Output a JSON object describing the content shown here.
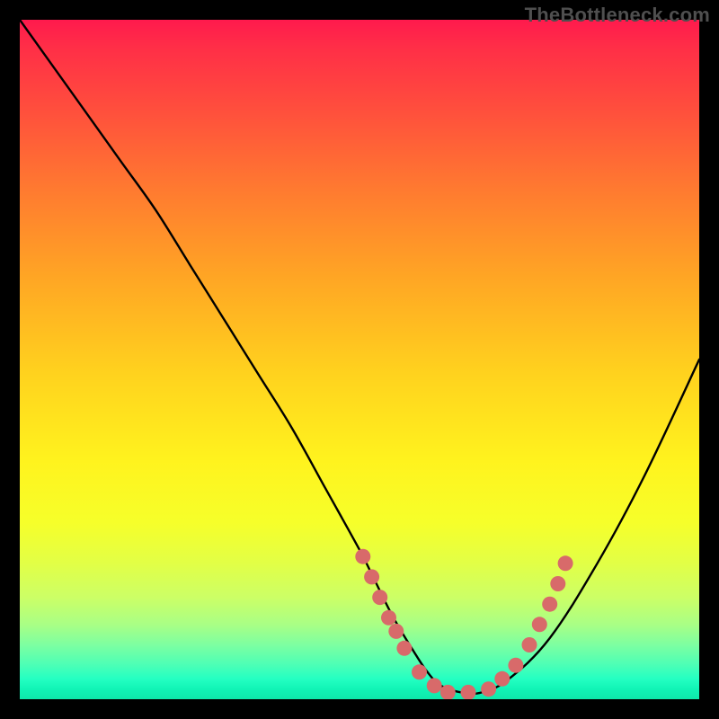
{
  "watermark": "TheBottleneck.com",
  "colors": {
    "frame": "#000000",
    "curve_stroke": "#000000",
    "marker_fill": "#d86a6a",
    "watermark_text": "#4f4f4f"
  },
  "chart_data": {
    "type": "line",
    "title": "",
    "xlabel": "",
    "ylabel": "",
    "xlim": [
      0,
      100
    ],
    "ylim": [
      0,
      100
    ],
    "grid": false,
    "legend": false,
    "description": "V-shaped bottleneck curve plotted over a vertical heat gradient (red top → green bottom). Lower y is better (closer to zero bottleneck). Salmon markers highlight sample points around the minimum.",
    "series": [
      {
        "name": "curve",
        "x": [
          0,
          5,
          10,
          15,
          20,
          25,
          30,
          35,
          40,
          45,
          50,
          52,
          55,
          58,
          60,
          62,
          65,
          68,
          72,
          78,
          85,
          92,
          100
        ],
        "y": [
          100,
          93,
          86,
          79,
          72,
          64,
          56,
          48,
          40,
          31,
          22,
          18,
          12,
          7,
          4,
          2,
          1,
          1,
          3,
          9,
          20,
          33,
          50
        ]
      }
    ],
    "markers": [
      {
        "x": 50.5,
        "y": 21
      },
      {
        "x": 51.8,
        "y": 18
      },
      {
        "x": 53.0,
        "y": 15
      },
      {
        "x": 54.3,
        "y": 12
      },
      {
        "x": 55.4,
        "y": 10
      },
      {
        "x": 56.6,
        "y": 7.5
      },
      {
        "x": 58.8,
        "y": 4
      },
      {
        "x": 61.0,
        "y": 2
      },
      {
        "x": 63.0,
        "y": 1
      },
      {
        "x": 66.0,
        "y": 1
      },
      {
        "x": 69.0,
        "y": 1.5
      },
      {
        "x": 71.0,
        "y": 3
      },
      {
        "x": 73.0,
        "y": 5
      },
      {
        "x": 75.0,
        "y": 8
      },
      {
        "x": 76.5,
        "y": 11
      },
      {
        "x": 78.0,
        "y": 14
      },
      {
        "x": 79.2,
        "y": 17
      },
      {
        "x": 80.3,
        "y": 20
      }
    ],
    "gradient_stops": [
      {
        "pos": 0.0,
        "color": "#ff1a4d"
      },
      {
        "pos": 0.5,
        "color": "#ffd21e"
      },
      {
        "pos": 0.78,
        "color": "#f6ff2a"
      },
      {
        "pos": 1.0,
        "color": "#0ee8aa"
      }
    ]
  }
}
